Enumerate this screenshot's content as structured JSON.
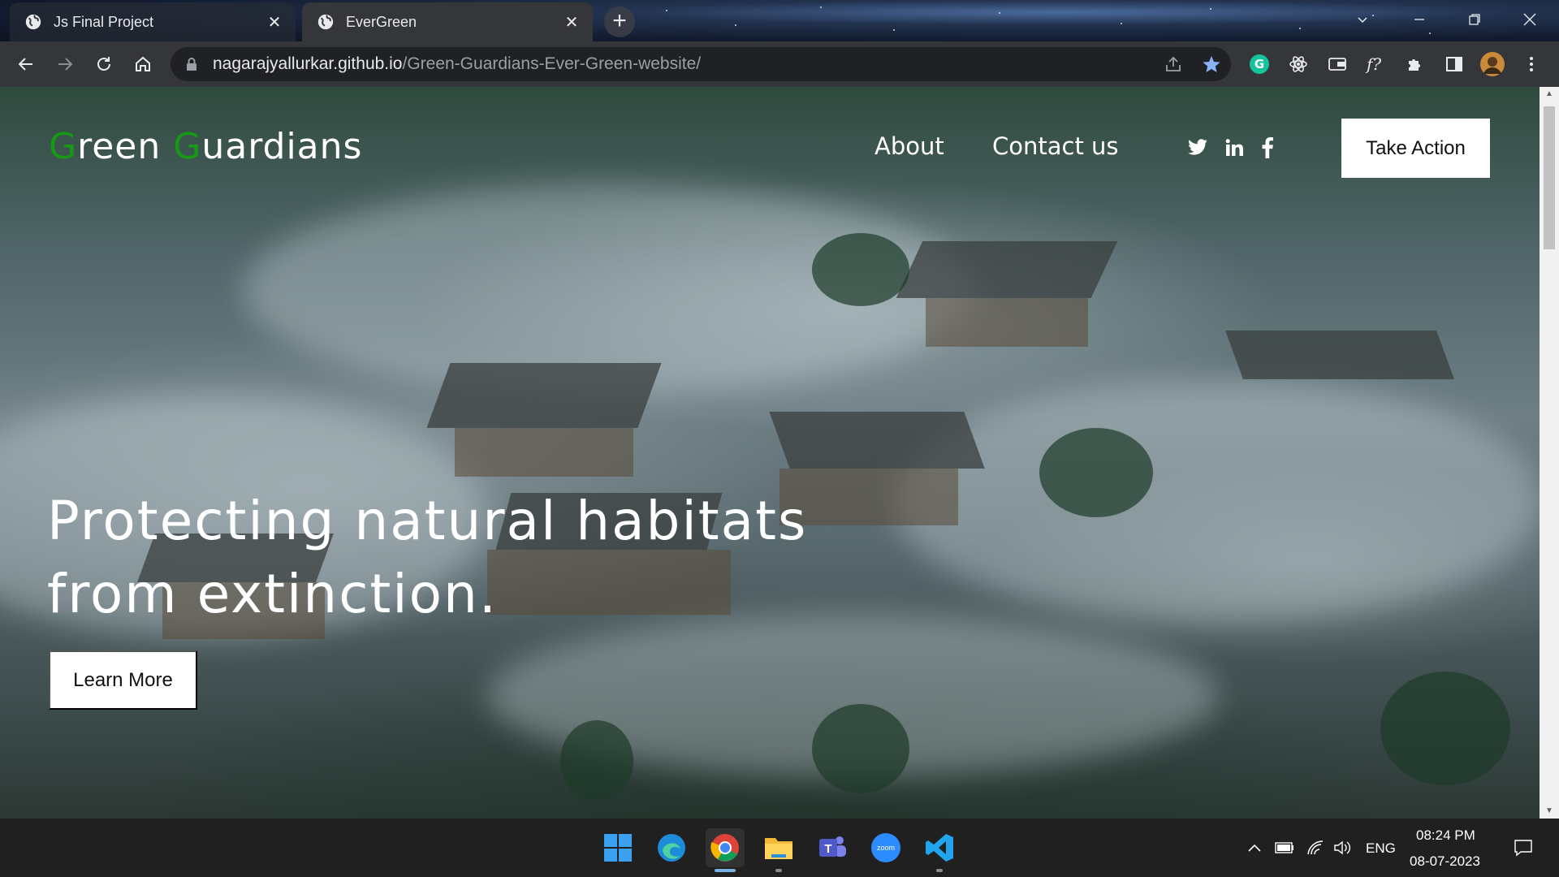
{
  "browser": {
    "tabs": [
      {
        "title": "Js Final Project",
        "active": false
      },
      {
        "title": "EverGreen",
        "active": true
      }
    ],
    "address": {
      "host": "nagarajyallurkar.github.io",
      "path": "/Green-Guardians-Ever-Green-website/"
    },
    "extensions": [
      "grammarly-icon",
      "atom-icon",
      "wallet-icon",
      "formula-icon",
      "puzzle-icon",
      "sidepanel-icon",
      "profile-avatar",
      "menu-icon"
    ]
  },
  "site": {
    "logo": {
      "g1": "G",
      "rest1": "reen ",
      "g2": "G",
      "rest2": "uardians"
    },
    "nav": {
      "about": "About",
      "contact": "Contact us"
    },
    "social": [
      "twitter-icon",
      "linkedin-icon",
      "facebook-icon"
    ],
    "cta": "Take Action",
    "hero": {
      "line1": "Protecting natural habitats",
      "line2": "from extinction."
    },
    "learn_more": "Learn More",
    "accent_color": "#169a16"
  },
  "taskbar": {
    "apps": [
      "windows-start-icon",
      "edge-icon",
      "chrome-icon",
      "file-explorer-icon",
      "teams-icon",
      "zoom-icon",
      "vscode-icon"
    ],
    "zoom_label": "zoom",
    "tray": {
      "lang": "ENG",
      "time": "08:24 PM",
      "date": "08-07-2023"
    }
  }
}
